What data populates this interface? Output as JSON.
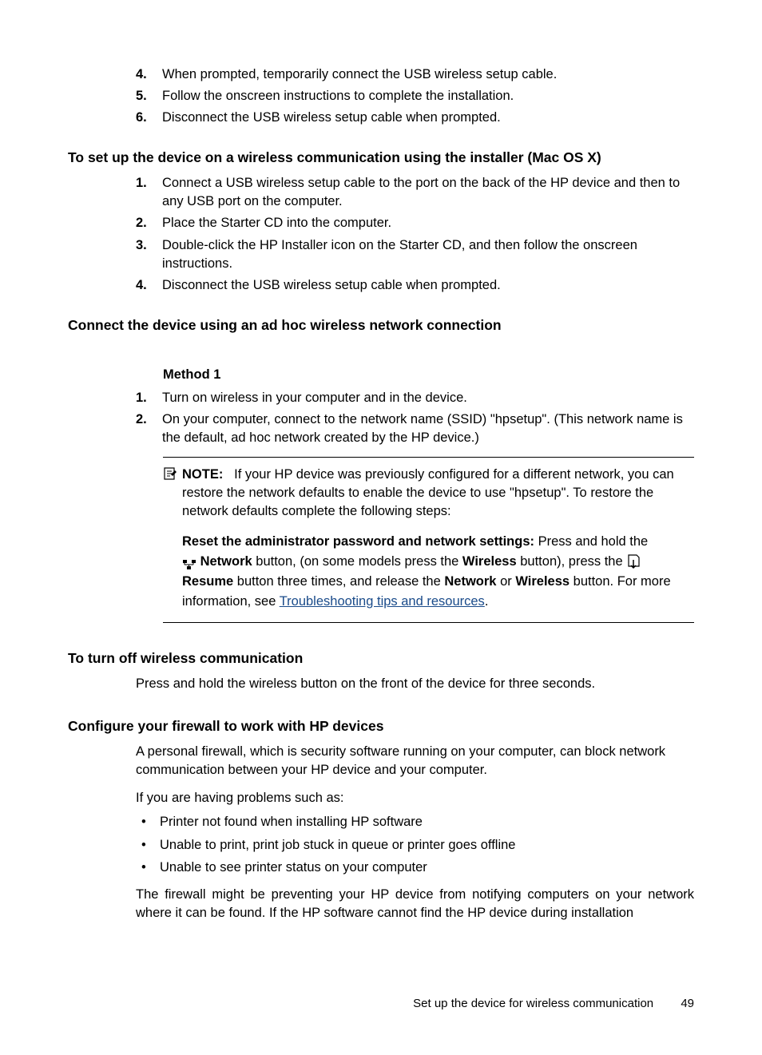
{
  "top_list": {
    "items": [
      {
        "num": "4.",
        "text": "When prompted, temporarily connect the USB wireless setup cable."
      },
      {
        "num": "5.",
        "text": "Follow the onscreen instructions to complete the installation."
      },
      {
        "num": "6.",
        "text": "Disconnect the USB wireless setup cable when prompted."
      }
    ]
  },
  "section1": {
    "heading": "To set up the device on a wireless communication using the installer (Mac OS X)",
    "items": [
      {
        "num": "1.",
        "text": "Connect a USB wireless setup cable to the port on the back of the HP device and then to any USB port on the computer."
      },
      {
        "num": "2.",
        "text": "Place the Starter CD into the computer."
      },
      {
        "num": "3.",
        "text": "Double-click the HP Installer icon on the Starter CD, and then follow the onscreen instructions."
      },
      {
        "num": "4.",
        "text": "Disconnect the USB wireless setup cable when prompted."
      }
    ]
  },
  "section2": {
    "heading": "Connect the device using an ad hoc wireless network connection",
    "method_label": "Method 1",
    "items": [
      {
        "num": "1.",
        "text": "Turn on wireless in your computer and in the device."
      },
      {
        "num": "2.",
        "text": "On your computer, connect to the network name (SSID) \"hpsetup\". (This network name is the default, ad hoc network created by the HP device.)"
      }
    ],
    "note": {
      "label": "NOTE:",
      "text1": "If your HP device was previously configured for a different network, you can restore the network defaults to enable the device to use \"hpsetup\". To restore the network defaults complete the following steps:",
      "reset_label": "Reset the administrator password and network settings:",
      "reset_text1": "Press and hold the",
      "network_label": "Network",
      "text2a": " button, (on some models press the ",
      "wireless_label": "Wireless",
      "text2b": " button), press the ",
      "resume_label": "Resume",
      "text3a": " button three times, and release the ",
      "network_label2": "Network",
      "text3b": " or ",
      "wireless_label2": "Wireless",
      "text3c": " button. For more information, see ",
      "link_text": "Troubleshooting tips and resources",
      "text3d": "."
    }
  },
  "section3": {
    "heading": "To turn off wireless communication",
    "body": "Press and hold the wireless button on the front of the device for three seconds."
  },
  "section4": {
    "heading": "Configure your firewall to work with HP devices",
    "body1": "A personal firewall, which is security software running on your computer, can block network communication between your HP device and your computer.",
    "body2": "If you are having problems such as:",
    "bullets": [
      "Printer not found when installing HP software",
      "Unable to print, print job stuck in queue or printer goes offline",
      "Unable to see printer status on your computer"
    ],
    "body3": "The firewall might be preventing your HP device from notifying computers on your network where it can be found. If the HP software cannot find the HP device during installation"
  },
  "footer": {
    "text": "Set up the device for wireless communication",
    "page": "49"
  }
}
